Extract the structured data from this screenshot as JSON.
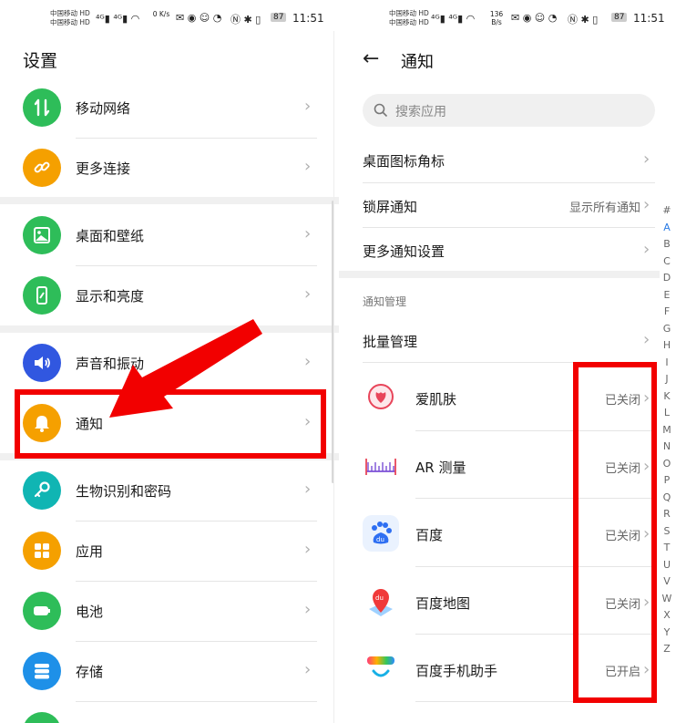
{
  "left_status": {
    "carrier1": "中国移动 HD",
    "carrier2": "中国移动 HD",
    "net_speed": "0 K/s",
    "battery": "87",
    "time": "11:51"
  },
  "right_status": {
    "carrier1": "中国移动 HD",
    "carrier2": "中国移动 HD",
    "net_speed": "136 B/s",
    "battery": "87",
    "time": "11:51"
  },
  "settings": {
    "title": "设置",
    "items": [
      {
        "label": "移动网络",
        "icon": "mobile-data-icon",
        "color": "#2ebd59"
      },
      {
        "label": "更多连接",
        "icon": "link-icon",
        "color": "#f5a000"
      },
      {
        "label": "桌面和壁纸",
        "icon": "image-icon",
        "color": "#2ebd59"
      },
      {
        "label": "显示和亮度",
        "icon": "phone-brightness-icon",
        "color": "#2ebd59"
      },
      {
        "label": "声音和振动",
        "icon": "speaker-icon",
        "color": "#3157e0"
      },
      {
        "label": "通知",
        "icon": "bell-icon",
        "color": "#f5a000"
      },
      {
        "label": "生物识别和密码",
        "icon": "key-icon",
        "color": "#10b5b3"
      },
      {
        "label": "应用",
        "icon": "apps-grid-icon",
        "color": "#f5a000"
      },
      {
        "label": "电池",
        "icon": "battery-icon",
        "color": "#2ebd59"
      },
      {
        "label": "存储",
        "icon": "storage-icon",
        "color": "#1e90e8"
      }
    ]
  },
  "notifications": {
    "title": "通知",
    "search_placeholder": "搜索应用",
    "options": [
      {
        "label": "桌面图标角标",
        "value": ""
      },
      {
        "label": "锁屏通知",
        "value": "显示所有通知"
      },
      {
        "label": "更多通知设置",
        "value": ""
      }
    ],
    "section_title": "通知管理",
    "batch_label": "批量管理",
    "apps": [
      {
        "name": "爱肌肤",
        "status": "已关闭"
      },
      {
        "name": "AR 测量",
        "status": "已关闭"
      },
      {
        "name": "百度",
        "status": "已关闭"
      },
      {
        "name": "百度地图",
        "status": "已关闭"
      },
      {
        "name": "百度手机助手",
        "status": "已开启"
      }
    ],
    "alphabet": [
      "#",
      "A",
      "B",
      "C",
      "D",
      "E",
      "F",
      "G",
      "H",
      "I",
      "J",
      "K",
      "L",
      "M",
      "N",
      "O",
      "P",
      "Q",
      "R",
      "S",
      "T",
      "U",
      "V",
      "W",
      "X",
      "Y",
      "Z"
    ],
    "alphabet_active": "A"
  },
  "colors": {
    "annotation": "#f20000",
    "accent": "#2a7be4"
  }
}
